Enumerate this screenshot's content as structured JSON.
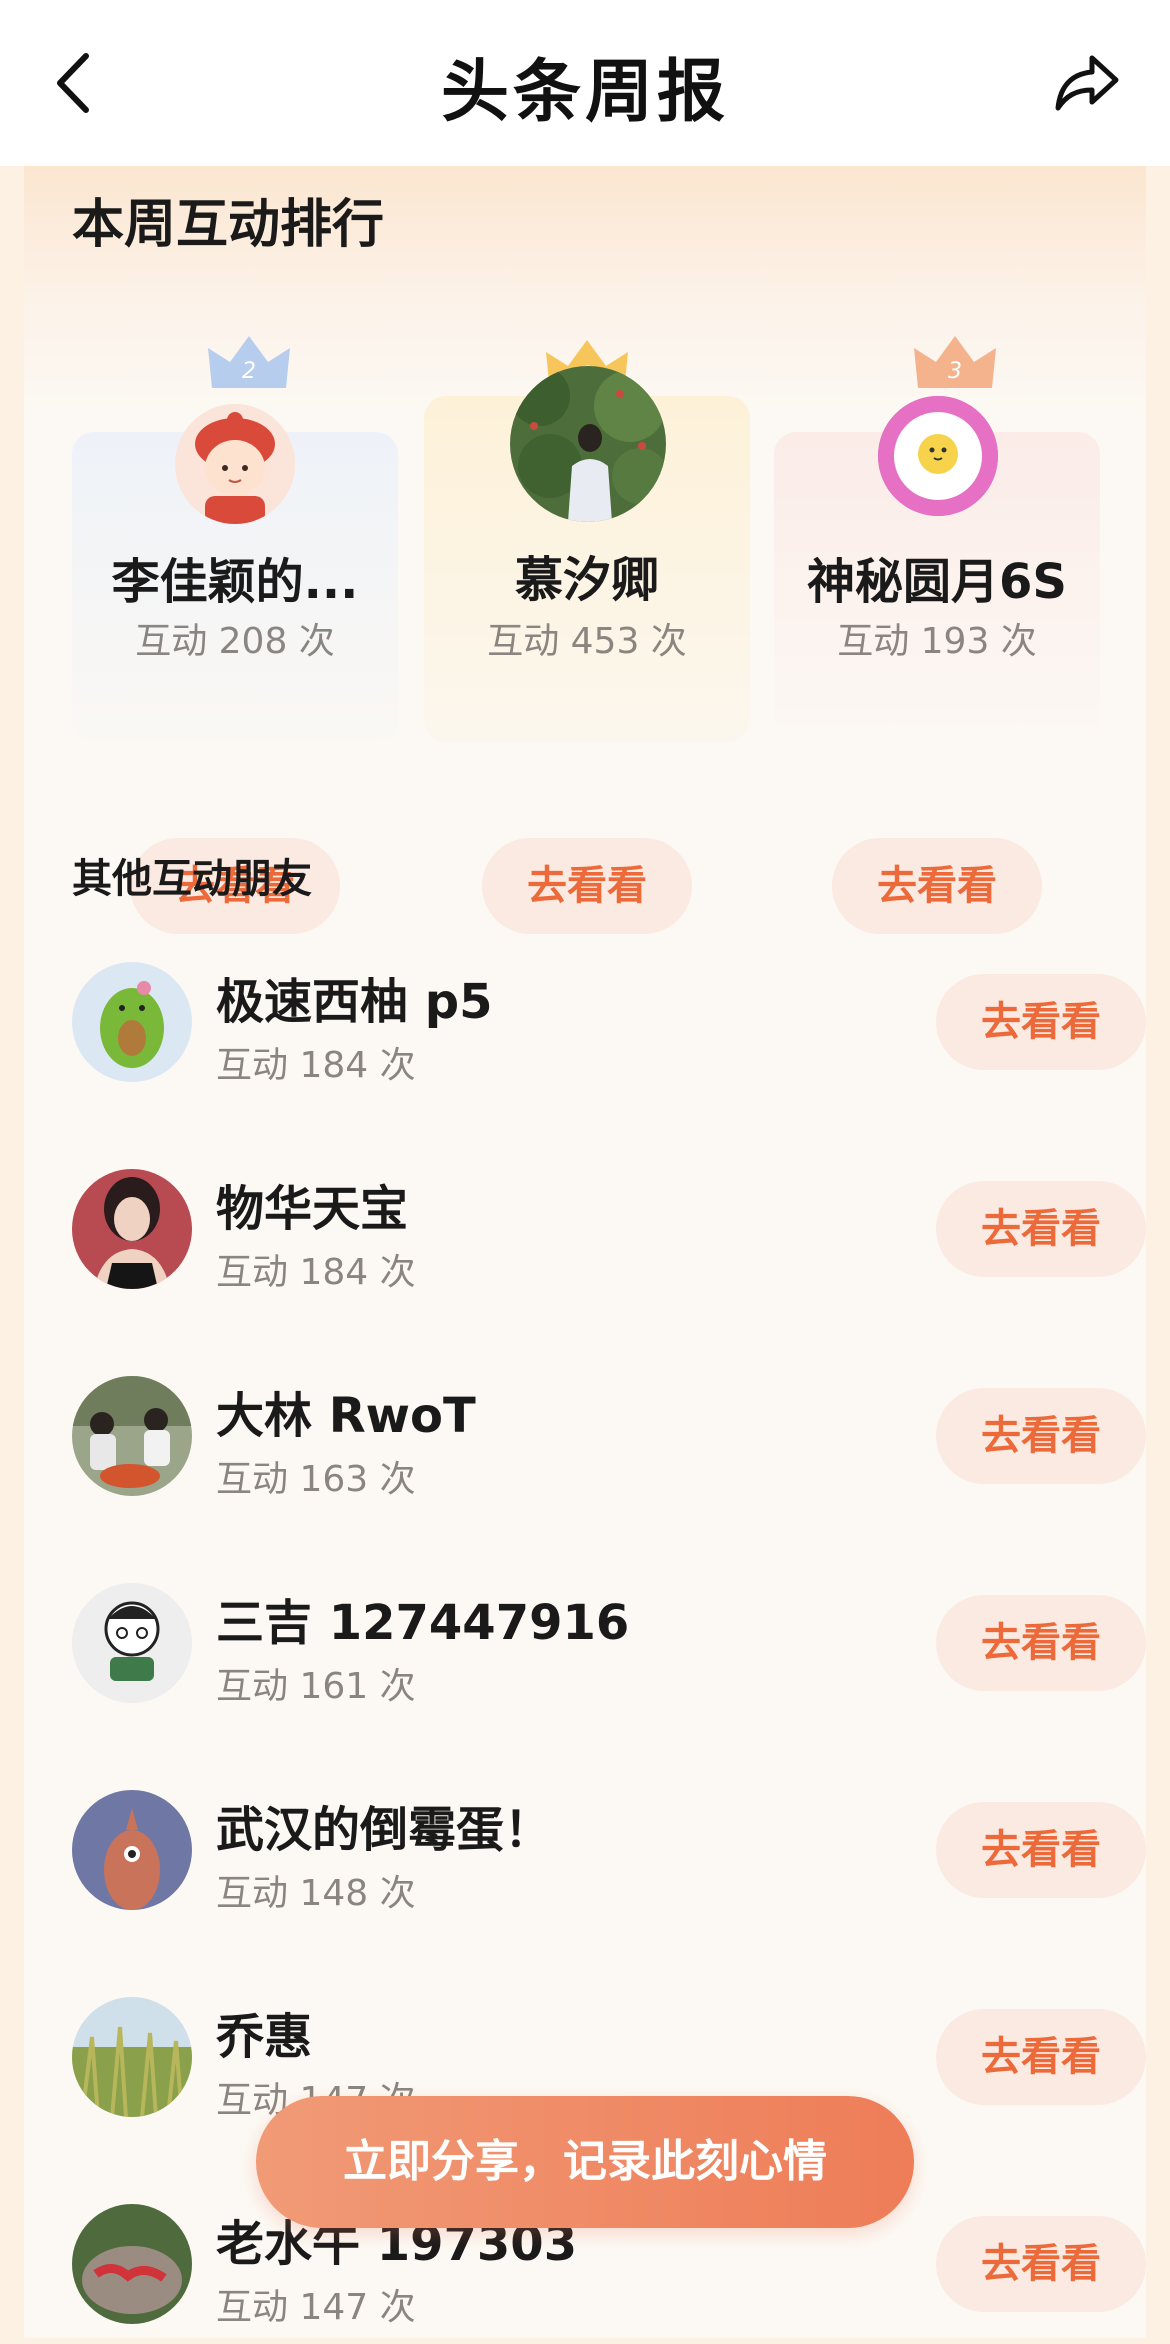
{
  "header": {
    "title": "头条周报",
    "back_icon": "chevron-left-icon",
    "share_icon": "share-arrow-icon"
  },
  "ranking": {
    "title": "本周互动排行",
    "top": [
      {
        "rank": 2,
        "name": "李佳颖的...",
        "count": "互动 208 次",
        "button": "去看看"
      },
      {
        "rank": 1,
        "name": "慕汐卿",
        "count": "互动 453 次",
        "button": "去看看"
      },
      {
        "rank": 3,
        "name": "神秘圆月6S",
        "count": "互动 193 次",
        "button": "去看看"
      }
    ]
  },
  "others": {
    "title": "其他互动朋友",
    "items": [
      {
        "name": "极速西柚 p5",
        "count": "互动 184 次",
        "button": "去看看"
      },
      {
        "name": "物华天宝",
        "count": "互动 184 次",
        "button": "去看看"
      },
      {
        "name": "大林 RwoT",
        "count": "互动 163 次",
        "button": "去看看"
      },
      {
        "name": "三吉 127447916",
        "count": "互动 161 次",
        "button": "去看看"
      },
      {
        "name": "武汉的倒霉蛋！",
        "count": "互动 148 次",
        "button": "去看看"
      },
      {
        "name": "乔惠",
        "count": "互动 147 次",
        "button": "去看看"
      },
      {
        "name": "老水牛 197303",
        "count": "互动 147 次",
        "button": "去看看"
      }
    ]
  },
  "share_cta": "立即分享，记录此刻心情",
  "colors": {
    "accent": "#ec6a3a",
    "button_bg": "#fbeae2",
    "cta_start": "#f19a76",
    "cta_end": "#ee7d58",
    "gold": "#f5c04a",
    "silver": "#a9c4ea",
    "bronze": "#f3a77e"
  }
}
